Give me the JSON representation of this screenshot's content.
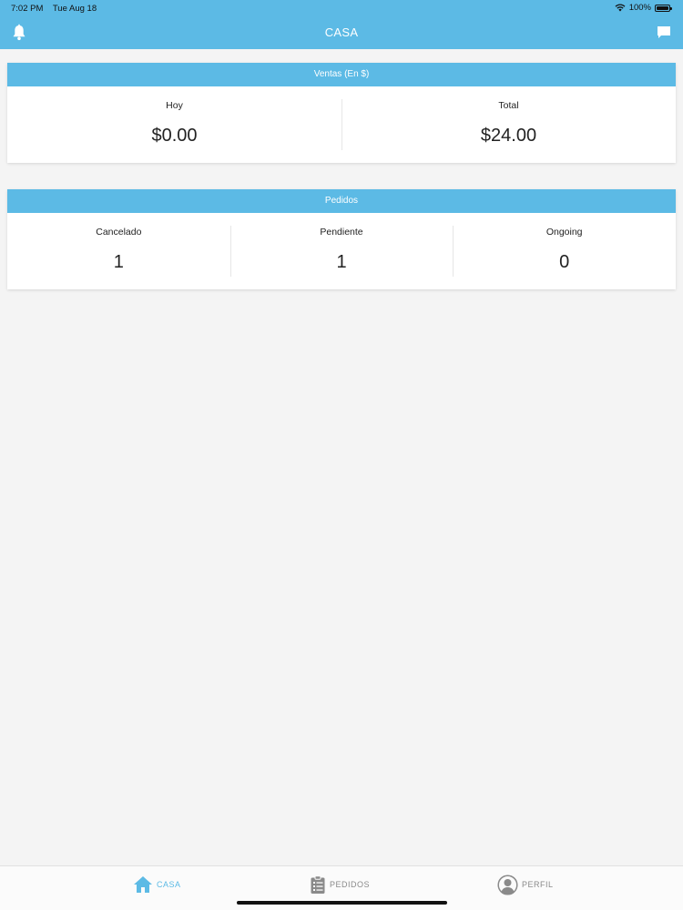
{
  "status_bar": {
    "time": "7:02 PM",
    "date": "Tue Aug 18",
    "battery": "100%"
  },
  "nav": {
    "title": "CASA",
    "left_icon": "bell-icon",
    "right_icon": "chat-icon"
  },
  "ventas": {
    "title": "Ventas (En $)",
    "stats": [
      {
        "label": "Hoy",
        "value": "$0.00"
      },
      {
        "label": "Total",
        "value": "$24.00"
      }
    ]
  },
  "pedidos": {
    "title": "Pedidos",
    "stats": [
      {
        "label": "Cancelado",
        "value": "1"
      },
      {
        "label": "Pendiente",
        "value": "1"
      },
      {
        "label": "Ongoing",
        "value": "0"
      }
    ]
  },
  "tabs": [
    {
      "label": "CASA",
      "icon": "home-icon",
      "active": true
    },
    {
      "label": "PEDIDOS",
      "icon": "clipboard-icon",
      "active": false
    },
    {
      "label": "PERFIL",
      "icon": "user-icon",
      "active": false
    }
  ],
  "colors": {
    "accent": "#5cbae5",
    "background": "#f4f4f4",
    "inactive": "#8a8a8a"
  }
}
